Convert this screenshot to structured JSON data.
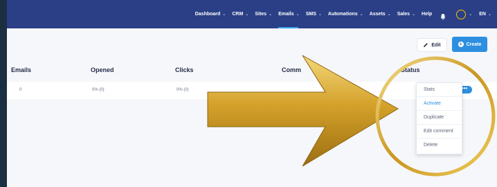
{
  "nav": {
    "items": [
      {
        "label": "Dashboard",
        "chevron": true
      },
      {
        "label": "CRM",
        "chevron": true
      },
      {
        "label": "Sites",
        "chevron": true
      },
      {
        "label": "Emails",
        "chevron": true,
        "active": true
      },
      {
        "label": "SMS",
        "chevron": true
      },
      {
        "label": "Automations",
        "chevron": true
      },
      {
        "label": "Assets",
        "chevron": true
      },
      {
        "label": "Sales",
        "chevron": true
      },
      {
        "label": "Help",
        "chevron": false
      }
    ],
    "language": "EN",
    "background": "#2a3f86",
    "active_underline": "#3aa0e8"
  },
  "toolbar": {
    "edit_label": "Edit",
    "create_label": "Create",
    "accent": "#2d8fe0"
  },
  "table": {
    "headers": [
      "Emails",
      "Opened",
      "Clicks",
      "Comm",
      "Status"
    ],
    "rows": [
      {
        "emails": "0",
        "opened": "0% (0)",
        "clicks": "0% (0)",
        "actions_label": "•••"
      }
    ]
  },
  "dropdown": {
    "items": [
      "Stats",
      "Activate",
      "Duplicate",
      "Edit comment",
      "Delete"
    ],
    "highlighted": "Activate"
  },
  "annotation": {
    "arrow_color": "#d4a12a",
    "circle_color": "#d9b23a"
  }
}
